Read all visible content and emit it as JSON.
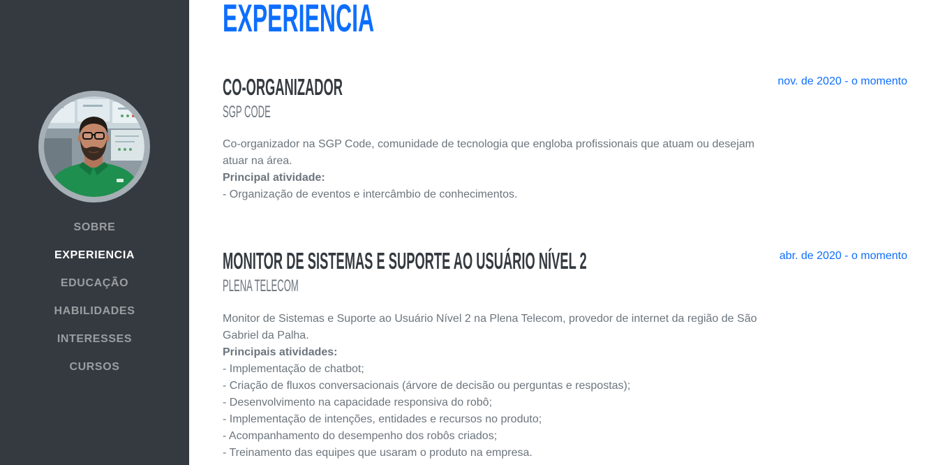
{
  "colors": {
    "primary": "#0d6efd",
    "sidebar_bg": "#343a40",
    "heading": "#343a40",
    "text": "#6c757d"
  },
  "sidebar": {
    "nav": [
      {
        "label": "SOBRE",
        "active": false
      },
      {
        "label": "EXPERIENCIA",
        "active": true
      },
      {
        "label": "EDUCAÇÃO",
        "active": false
      },
      {
        "label": "HABILIDADES",
        "active": false
      },
      {
        "label": "INTERESSES",
        "active": false
      },
      {
        "label": "CURSOS",
        "active": false
      }
    ]
  },
  "main": {
    "section_title": "EXPERIENCIA",
    "items": [
      {
        "role": "CO-ORGANIZADOR",
        "company": "SGP CODE",
        "date": "nov. de 2020 - o momento",
        "description": "Co-organizador na SGP Code, comunidade de tecnologia que engloba profissionais que atuam ou desejam atuar na área.",
        "activities_label": "Principal atividade:",
        "activities": [
          "- Organização de eventos e intercâmbio de conhecimentos."
        ]
      },
      {
        "role": "MONITOR DE SISTEMAS E SUPORTE AO USUÁRIO NÍVEL 2",
        "company": "PLENA TELECOM",
        "date": "abr. de 2020 - o momento",
        "description": "Monitor de Sistemas e Suporte ao Usuário Nível 2 na Plena Telecom, provedor de internet da região de São Gabriel da Palha.",
        "activities_label": "Principais atividades:",
        "activities": [
          "- Implementação de chatbot;",
          "- Criação de fluxos conversacionais (árvore de decisão ou perguntas e respostas);",
          "- Desenvolvimento na capacidade responsiva do robô;",
          "- Implementação de intenções, entidades e recursos no produto;",
          "- Acompanhamento do desempenho dos robôs criados;",
          "- Treinamento das equipes que usaram o produto na empresa."
        ]
      }
    ]
  }
}
